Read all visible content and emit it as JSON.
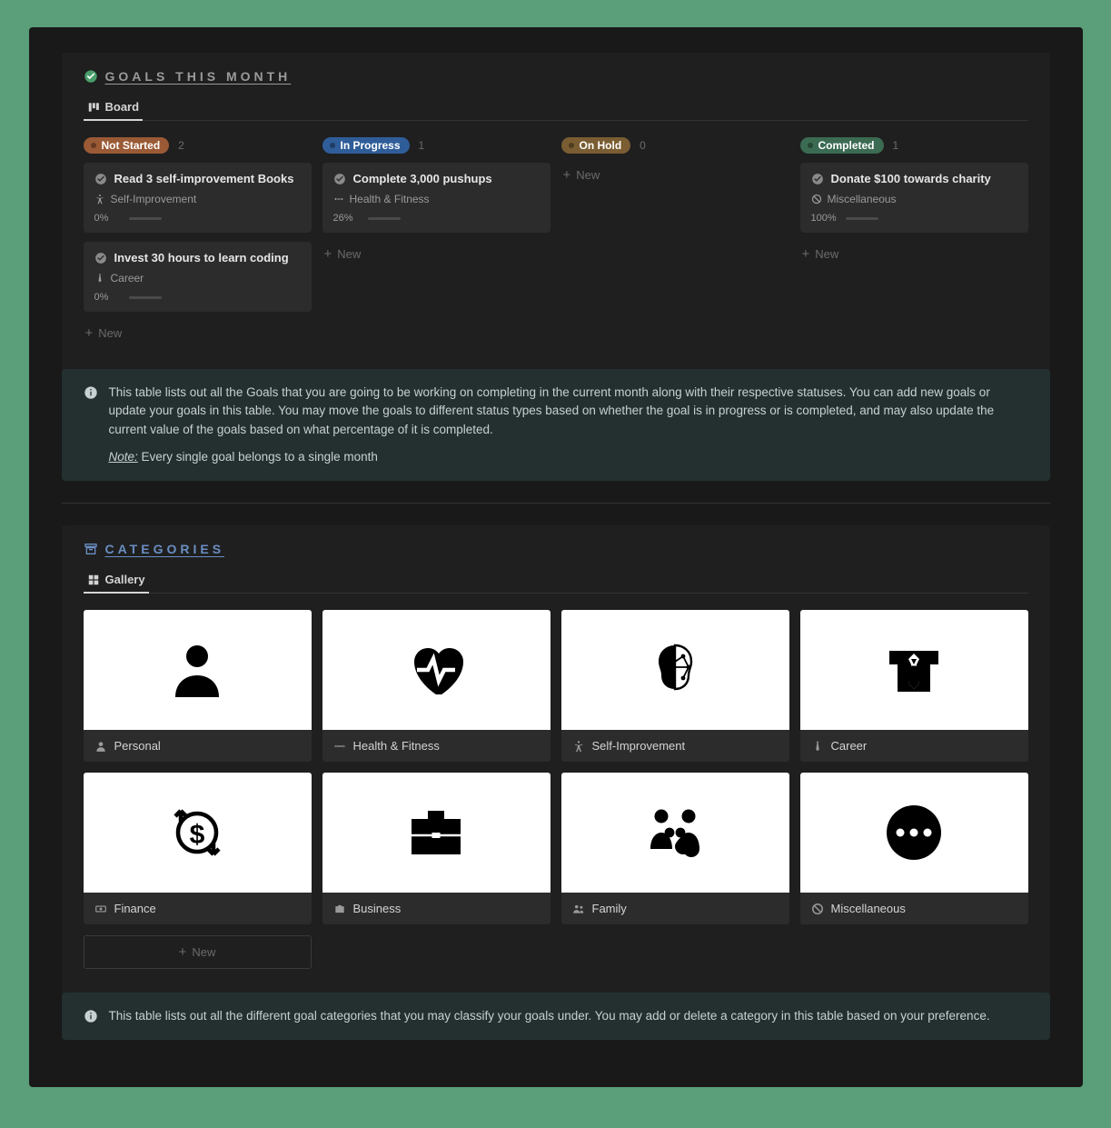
{
  "goals_section": {
    "title": "GOALS THIS MONTH",
    "tab_label": "Board",
    "columns": [
      {
        "status_label": "Not Started",
        "badge_class": "badge-notstarted",
        "count": "2",
        "cards": [
          {
            "title": "Read 3 self-improvement Books",
            "tag": "Self-Improvement",
            "tag_icon": "accessibility",
            "pct": "0%",
            "pct_val": 0
          },
          {
            "title": "Invest 30 hours to learn coding",
            "tag": "Career",
            "tag_icon": "tie",
            "pct": "0%",
            "pct_val": 0
          }
        ],
        "new_label": "New"
      },
      {
        "status_label": "In Progress",
        "badge_class": "badge-inprogress",
        "count": "1",
        "cards": [
          {
            "title": "Complete 3,000 pushups",
            "tag": "Health & Fitness",
            "tag_icon": "dumbbell",
            "pct": "26%",
            "pct_val": 26
          }
        ],
        "new_label": "New"
      },
      {
        "status_label": "On Hold",
        "badge_class": "badge-onhold",
        "count": "0",
        "cards": [],
        "new_label": "New"
      },
      {
        "status_label": "Completed",
        "badge_class": "badge-completed",
        "count": "1",
        "cards": [
          {
            "title": "Donate $100 towards charity",
            "tag": "Miscellaneous",
            "tag_icon": "ban",
            "pct": "100%",
            "pct_val": 100
          }
        ],
        "new_label": "New"
      }
    ],
    "info_p1": "This table lists out all the Goals that you are going to be working on completing in the current month along with their respective statuses. You can add new goals or update your goals in this table. You may move the goals to different status types based on whether the goal is in progress or is completed, and may also update the current value of the goals based on what percentage of it is completed.",
    "info_note_label": "Note:",
    "info_note_text": " Every single goal belongs to a single month"
  },
  "categories_section": {
    "title": "CATEGORIES",
    "tab_label": "Gallery",
    "items": [
      {
        "label": "Personal",
        "icon": "person",
        "label_icon": "person-small"
      },
      {
        "label": "Health & Fitness",
        "icon": "heart",
        "label_icon": "dumbbell"
      },
      {
        "label": "Self-Improvement",
        "icon": "brain",
        "label_icon": "accessibility"
      },
      {
        "label": "Career",
        "icon": "tie",
        "label_icon": "tie"
      },
      {
        "label": "Finance",
        "icon": "money",
        "label_icon": "cash"
      },
      {
        "label": "Business",
        "icon": "briefcase",
        "label_icon": "briefcase-small"
      },
      {
        "label": "Family",
        "icon": "family",
        "label_icon": "people"
      },
      {
        "label": "Miscellaneous",
        "icon": "dots",
        "label_icon": "ban"
      }
    ],
    "new_label": "New",
    "info_text": "This table lists out all the different goal categories that you may classify your goals under. You may add or delete a category in this table based on your preference."
  }
}
